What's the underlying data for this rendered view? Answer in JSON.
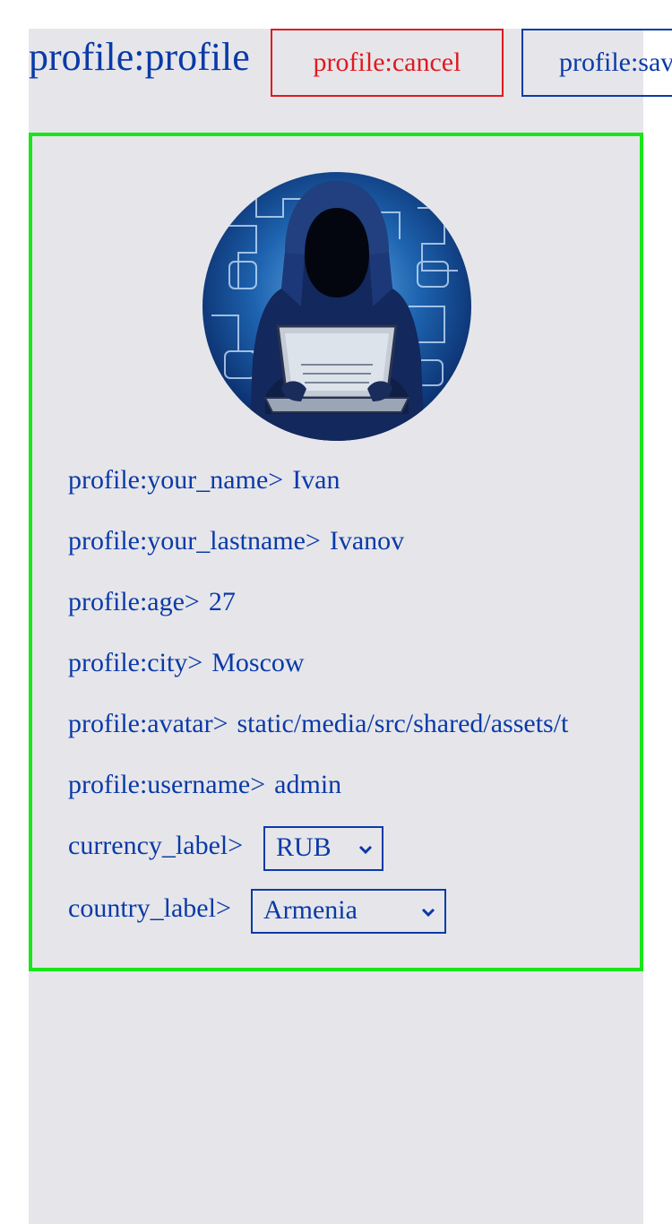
{
  "header": {
    "title": "profile:profile",
    "cancel_label": "profile:cancel",
    "save_label": "profile:save"
  },
  "profile": {
    "avatar_alt": "hooded figure with laptop",
    "fields": [
      {
        "label": "profile:your_name>",
        "value": "Ivan"
      },
      {
        "label": "profile:your_lastname>",
        "value": "Ivanov"
      },
      {
        "label": "profile:age>",
        "value": "27"
      },
      {
        "label": "profile:city>",
        "value": "Moscow"
      },
      {
        "label": "profile:avatar>",
        "value": "static/media/src/shared/assets/t"
      },
      {
        "label": "profile:username>",
        "value": "admin"
      }
    ],
    "currency": {
      "label": "currency_label>",
      "selected": "RUB"
    },
    "country": {
      "label": "country_label>",
      "selected": "Armenia"
    }
  },
  "colors": {
    "accent": "#0a3aa8",
    "danger": "#e0191e",
    "card_border": "#19e619",
    "background": "#e6e6ea"
  }
}
